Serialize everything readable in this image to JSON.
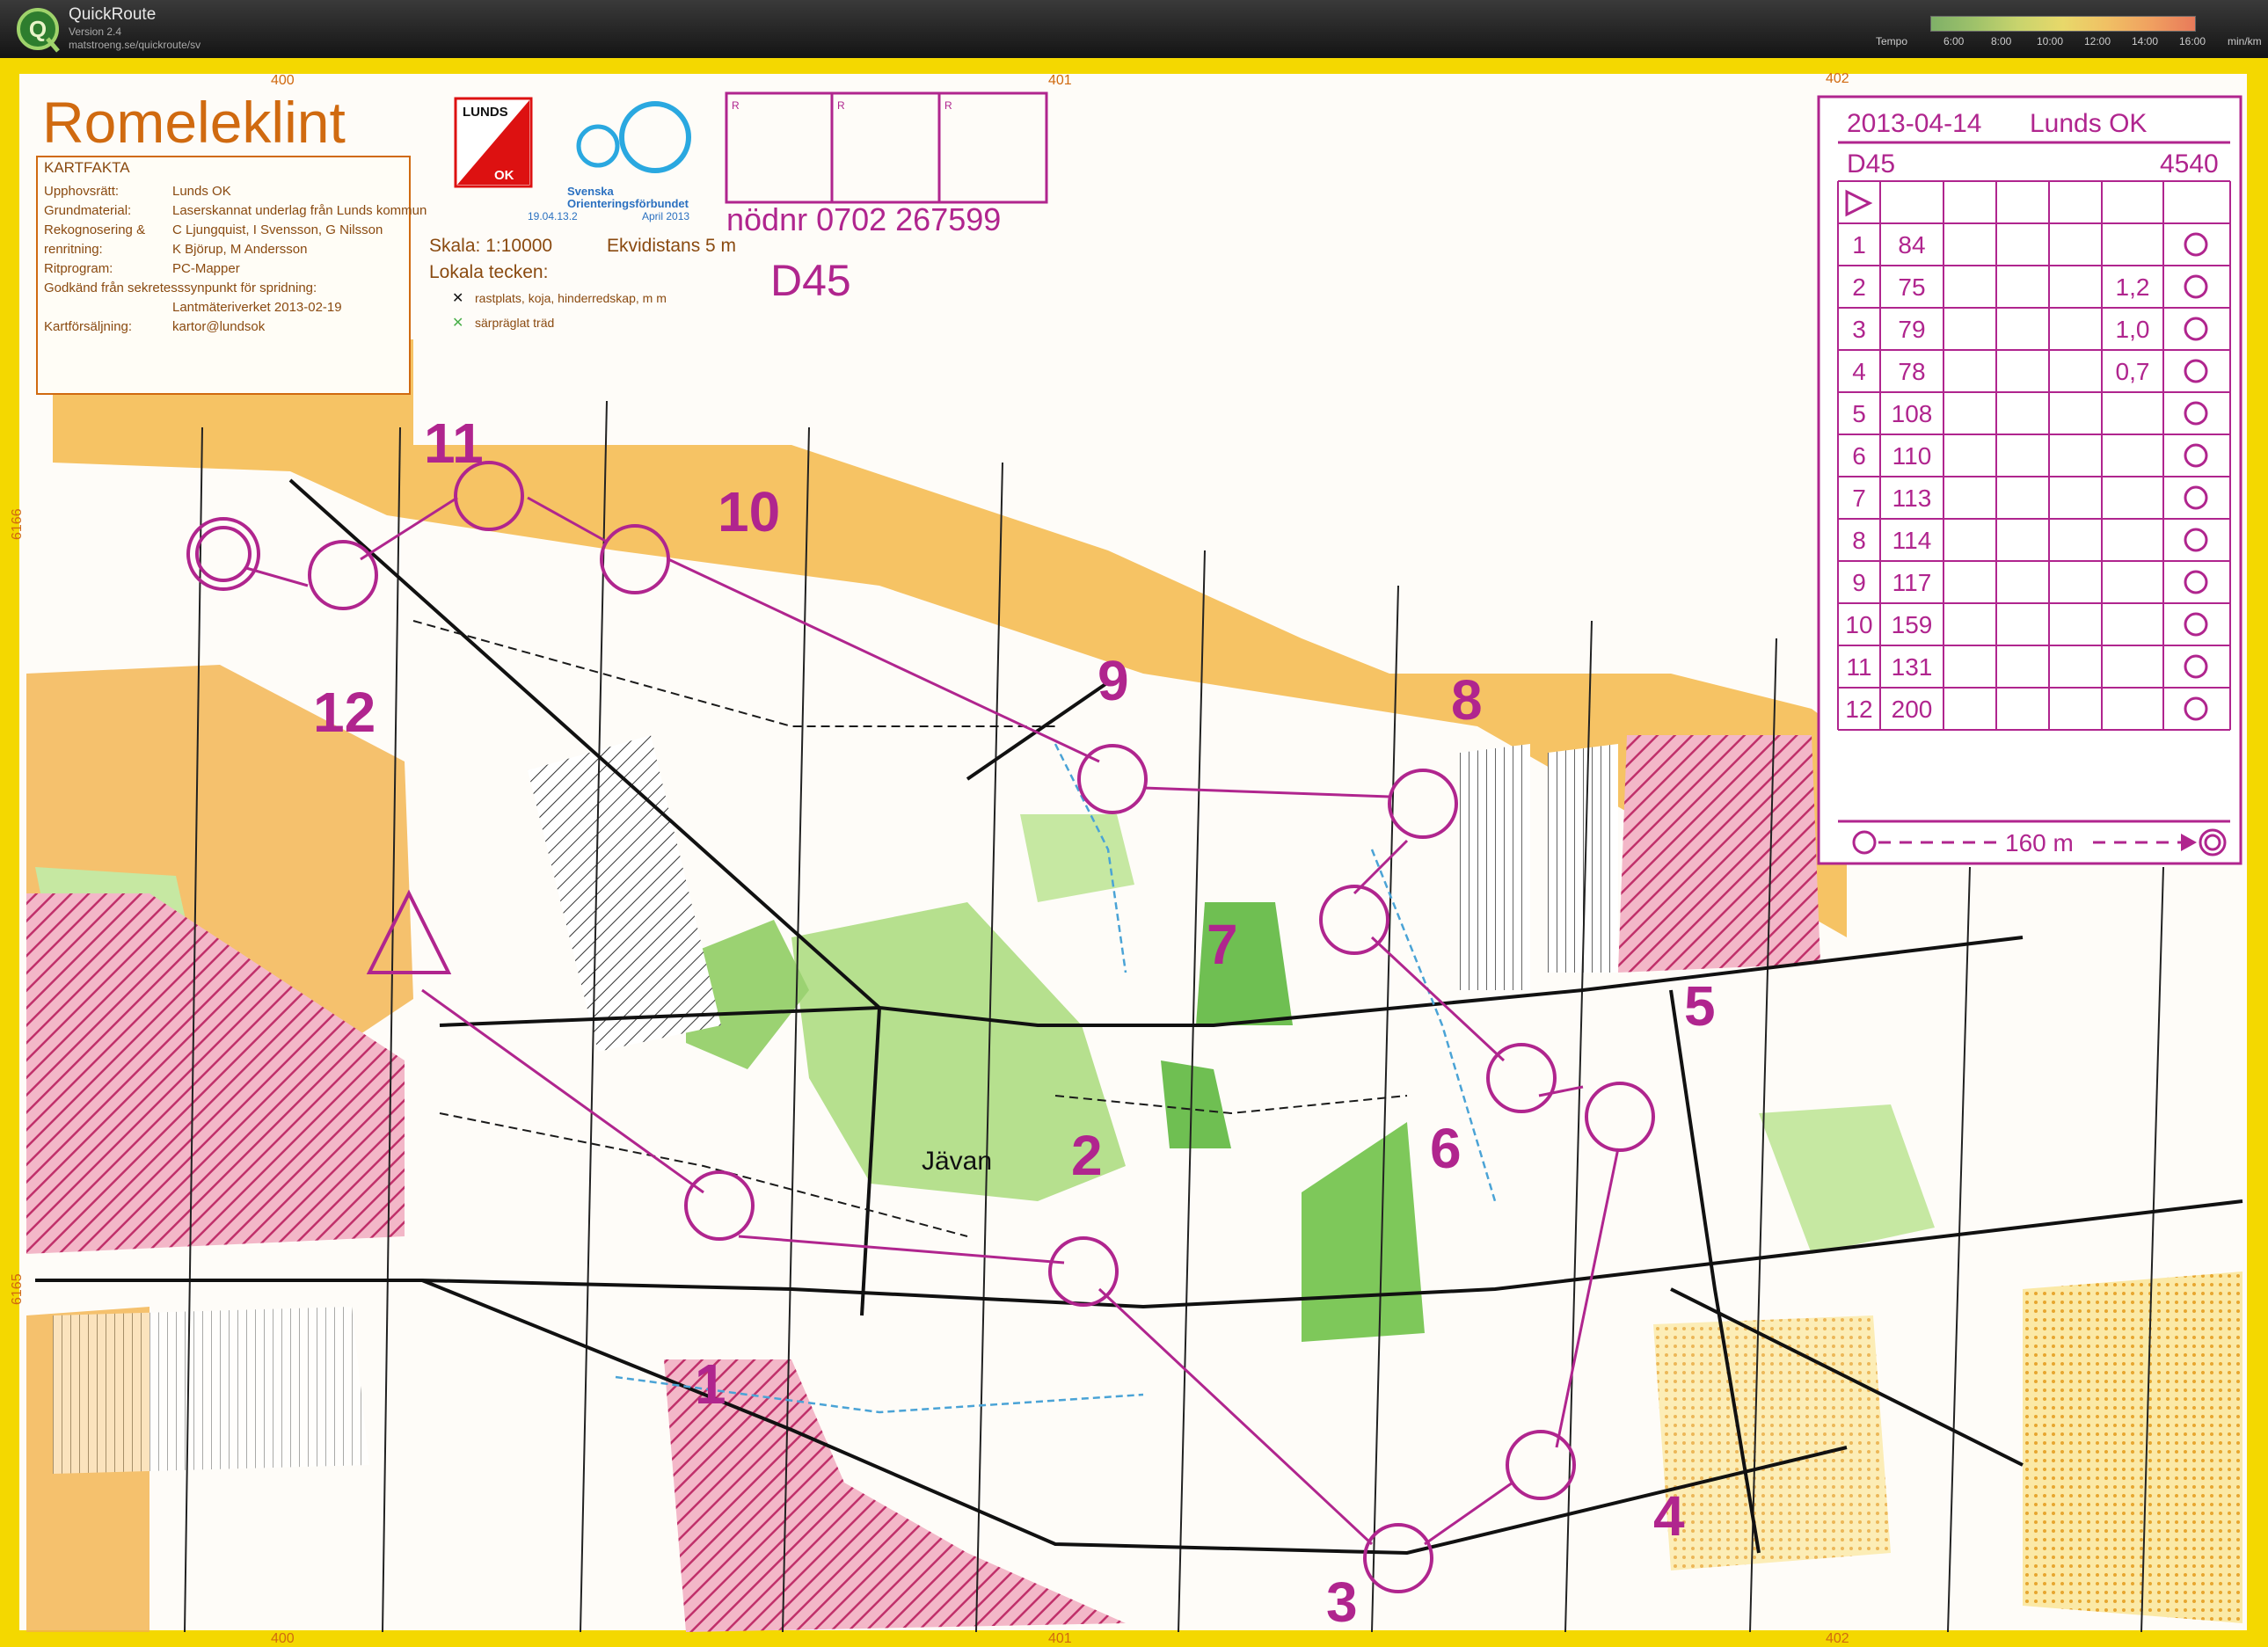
{
  "app": {
    "title": "QuickRoute",
    "version": "Version 2.4",
    "url": "matstroeng.se/quickroute/sv",
    "logo_letter": "Q"
  },
  "tempo": {
    "label": "Tempo",
    "ticks": [
      "6:00",
      "8:00",
      "10:00",
      "12:00",
      "14:00",
      "16:00"
    ],
    "unit": "min/km"
  },
  "map": {
    "title": "Romeleklint",
    "jarvan": "Jävan",
    "grid_top": [
      "400",
      "401",
      "402"
    ],
    "grid_bottom": [
      "400",
      "401",
      "402"
    ],
    "grid_side": [
      "6166",
      "6165"
    ],
    "colors": {
      "course": "#b0258e",
      "frame": "#f4d800",
      "open": "#f2b545",
      "forest": "#8cc86a"
    }
  },
  "kartfakta": {
    "title": "KARTFAKTA",
    "rows": [
      {
        "label": "Upphovsrätt:",
        "value": "Lunds OK"
      },
      {
        "label": "Grundmaterial:",
        "value": "Laserskannat underlag från Lunds kommun"
      },
      {
        "label": "Rekognosering &",
        "value": "C Ljungquist, I Svensson, G Nilsson"
      },
      {
        "label": "renritning:",
        "value": "K Björup, M Andersson"
      },
      {
        "label": "Ritprogram:",
        "value": "PC-Mapper"
      },
      {
        "label": "Godkänd från sekretesssynpunkt för spridning:",
        "value": ""
      },
      {
        "label": "",
        "value": "Lantmäteriverket 2013-02-19"
      },
      {
        "label": "Kartförsäljning:",
        "value": "kartor@lundsok"
      }
    ]
  },
  "logos": {
    "lunds": "LUNDS",
    "ok": "OK",
    "sof_line1": "Svenska",
    "sof_line2": "Orienteringsförbundet",
    "sof_line3": "19.04.13.2",
    "sof_line4": "April 2013"
  },
  "scale": {
    "skala": "Skala: 1:10000",
    "ekvidistans": "Ekvidistans 5 m",
    "lokala": "Lokala tecken:",
    "legend1": "rastplats, koja, hinderredskap, m m",
    "legend2": "särpräglat träd"
  },
  "stamp": {
    "boxes": [
      "R",
      "R",
      "R"
    ],
    "nodnr": "nödnr 0702 267599",
    "class": "D45"
  },
  "controls": {
    "labels": [
      "1",
      "2",
      "3",
      "4",
      "5",
      "6",
      "7",
      "8",
      "9",
      "10",
      "11",
      "12"
    ]
  },
  "descriptions": {
    "date": "2013-04-14",
    "club": "Lunds OK",
    "class": "D45",
    "length": "4540",
    "rows": [
      {
        "n": "1",
        "code": "84",
        "extra": ""
      },
      {
        "n": "2",
        "code": "75",
        "extra": "1,2"
      },
      {
        "n": "3",
        "code": "79",
        "extra": "1,0"
      },
      {
        "n": "4",
        "code": "78",
        "extra": "0,7"
      },
      {
        "n": "5",
        "code": "108",
        "extra": ""
      },
      {
        "n": "6",
        "code": "110",
        "extra": ""
      },
      {
        "n": "7",
        "code": "113",
        "extra": ""
      },
      {
        "n": "8",
        "code": "114",
        "extra": ""
      },
      {
        "n": "9",
        "code": "117",
        "extra": ""
      },
      {
        "n": "10",
        "code": "159",
        "extra": ""
      },
      {
        "n": "11",
        "code": "131",
        "extra": ""
      },
      {
        "n": "12",
        "code": "200",
        "extra": ""
      }
    ],
    "finish": "160 m"
  }
}
